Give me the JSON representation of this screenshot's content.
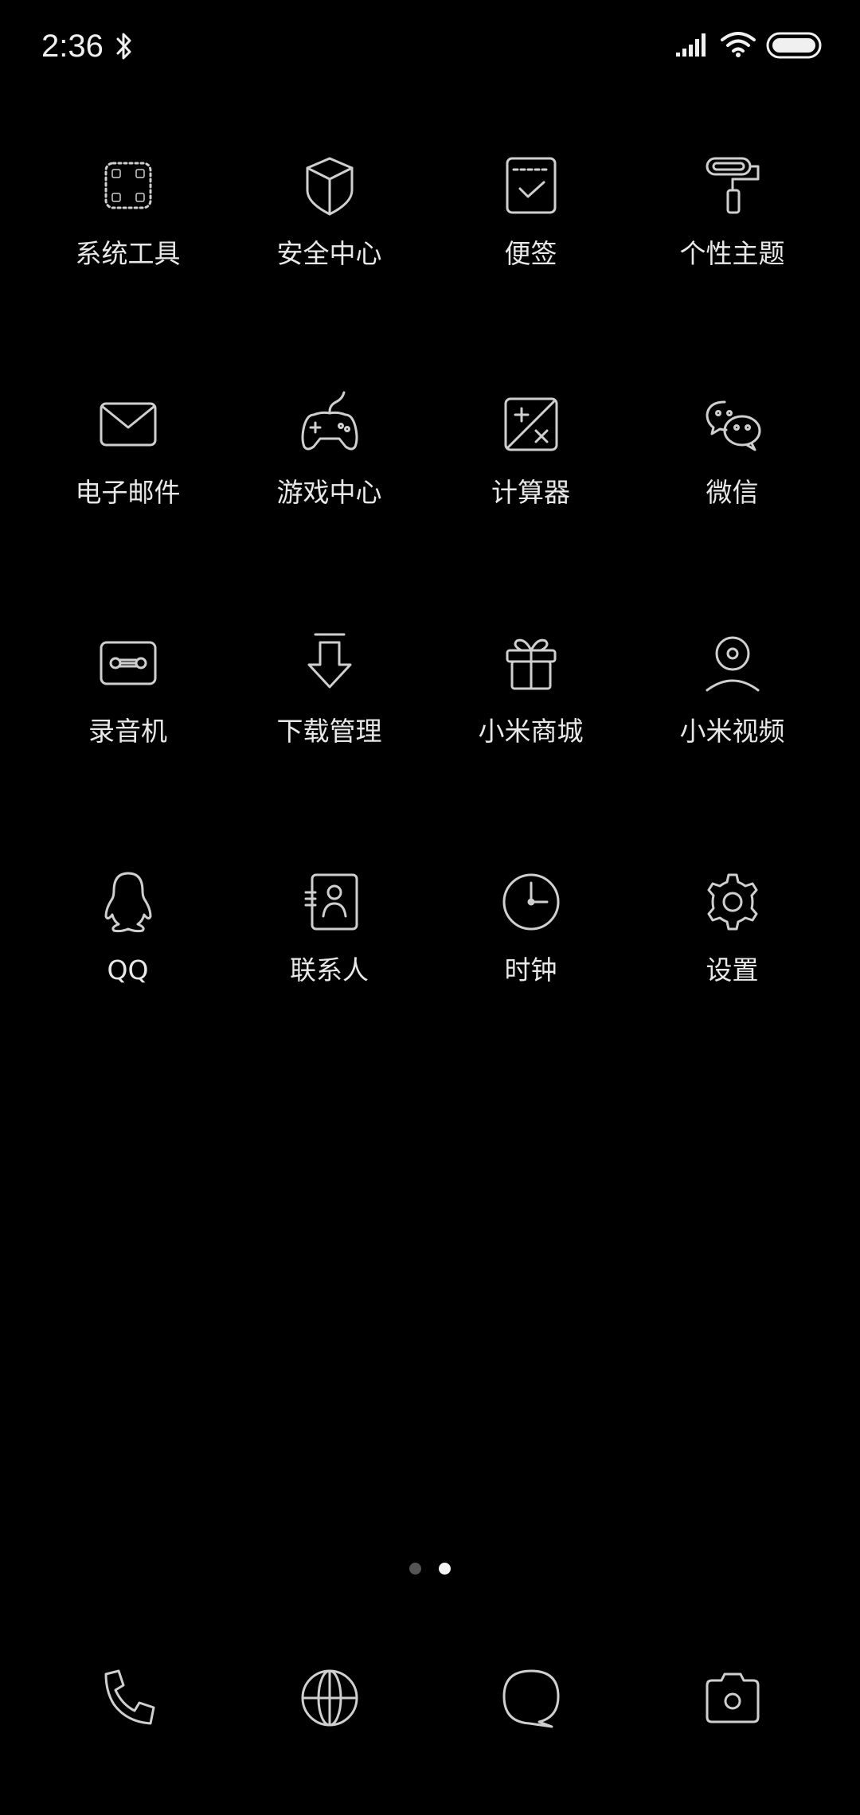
{
  "status_bar": {
    "time": "2:36",
    "icons": [
      "bluetooth-icon",
      "signal-icon",
      "wifi-icon",
      "battery-icon"
    ]
  },
  "apps": [
    {
      "label": "系统工具",
      "icon": "folder-icon"
    },
    {
      "label": "安全中心",
      "icon": "shield-icon"
    },
    {
      "label": "便签",
      "icon": "notes-icon"
    },
    {
      "label": "个性主题",
      "icon": "paint-roller-icon"
    },
    {
      "label": "电子邮件",
      "icon": "mail-icon"
    },
    {
      "label": "游戏中心",
      "icon": "gamepad-icon"
    },
    {
      "label": "计算器",
      "icon": "calculator-icon"
    },
    {
      "label": "微信",
      "icon": "wechat-icon"
    },
    {
      "label": "录音机",
      "icon": "recorder-icon"
    },
    {
      "label": "下载管理",
      "icon": "download-icon"
    },
    {
      "label": "小米商城",
      "icon": "gift-icon"
    },
    {
      "label": "小米视频",
      "icon": "video-icon"
    },
    {
      "label": "QQ",
      "icon": "qq-icon"
    },
    {
      "label": "联系人",
      "icon": "contacts-icon"
    },
    {
      "label": "时钟",
      "icon": "clock-icon"
    },
    {
      "label": "设置",
      "icon": "gear-icon"
    }
  ],
  "page_indicator": {
    "pages": 2,
    "current": 2
  },
  "dock": [
    {
      "icon": "phone-icon"
    },
    {
      "icon": "browser-icon"
    },
    {
      "icon": "message-icon"
    },
    {
      "icon": "camera-icon"
    }
  ]
}
